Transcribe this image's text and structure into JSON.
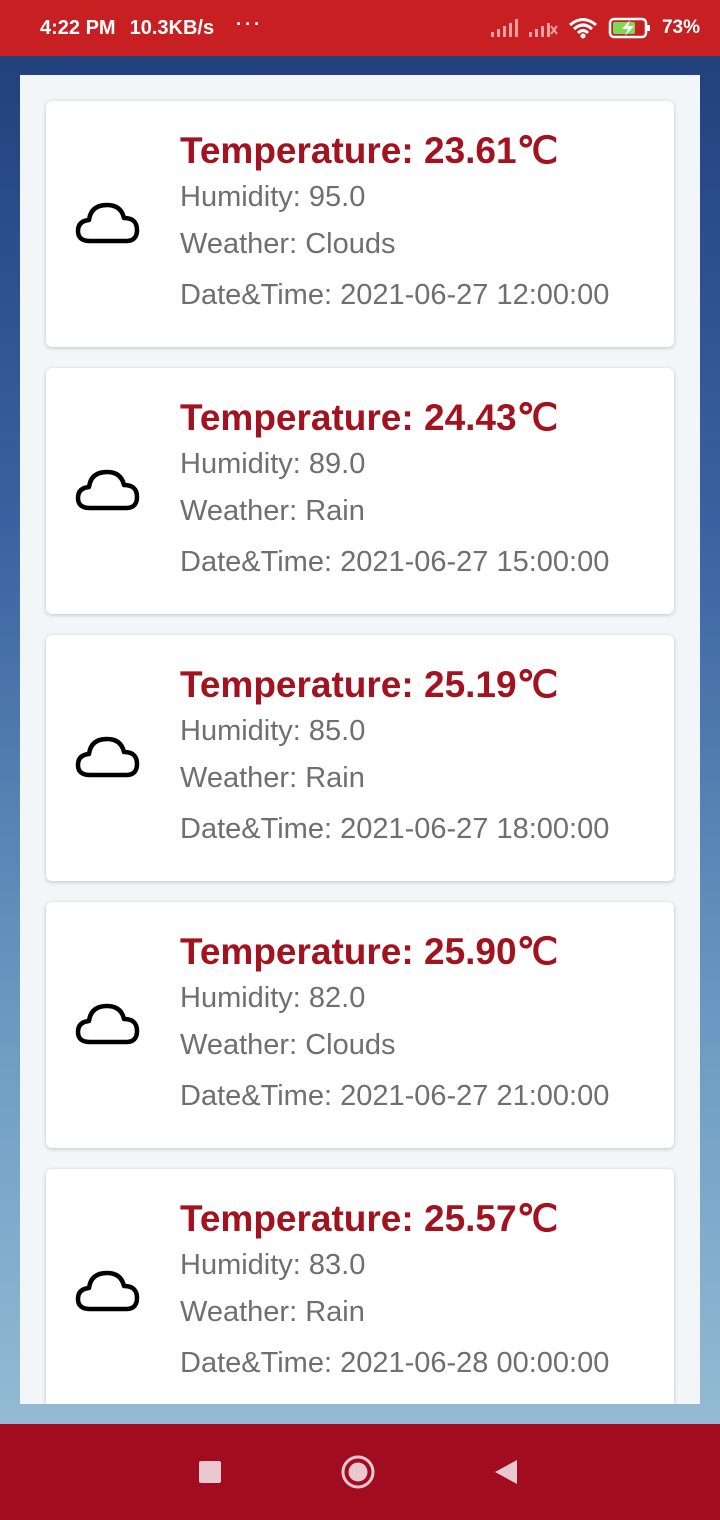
{
  "status_bar": {
    "time": "4:22 PM",
    "network_speed": "10.3KB/s",
    "more": "···",
    "battery": "73%"
  },
  "forecasts": [
    {
      "temperature": "Temperature: 23.61℃",
      "humidity": "Humidity: 95.0",
      "weather": "Weather: Clouds",
      "datetime": "Date&Time: 2021-06-27 12:00:00",
      "icon": "cloud-icon"
    },
    {
      "temperature": "Temperature: 24.43℃",
      "humidity": "Humidity: 89.0",
      "weather": "Weather: Rain",
      "datetime": "Date&Time: 2021-06-27 15:00:00",
      "icon": "cloud-icon"
    },
    {
      "temperature": "Temperature: 25.19℃",
      "humidity": "Humidity: 85.0",
      "weather": "Weather: Rain",
      "datetime": "Date&Time: 2021-06-27 18:00:00",
      "icon": "cloud-icon"
    },
    {
      "temperature": "Temperature: 25.90℃",
      "humidity": "Humidity: 82.0",
      "weather": "Weather: Clouds",
      "datetime": "Date&Time: 2021-06-27 21:00:00",
      "icon": "cloud-icon"
    },
    {
      "temperature": "Temperature: 25.57℃",
      "humidity": "Humidity: 83.0",
      "weather": "Weather: Rain",
      "datetime": "Date&Time: 2021-06-28 00:00:00",
      "icon": "cloud-icon"
    }
  ],
  "nav_bar": {
    "buttons": [
      "recents-icon",
      "home-icon",
      "back-icon"
    ]
  },
  "colors": {
    "status_bar": "#c71f22",
    "nav_bar": "#a10c20",
    "temperature_text": "#a3121f",
    "detail_text": "#6f6f6f"
  }
}
